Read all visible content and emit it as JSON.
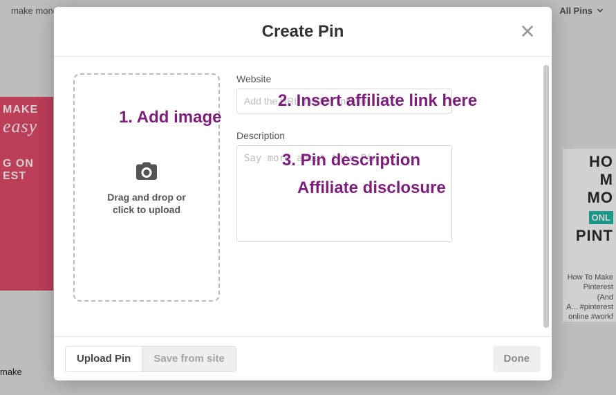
{
  "background": {
    "search_text": "make money pinning on pinterest",
    "filter_label": "All Pins",
    "left_card": {
      "l1": "MAKE",
      "l2": "easy",
      "l3": "G ON",
      "l4": "EST"
    },
    "left_caption": "make",
    "right_card": {
      "l1": "HO",
      "l2": "M",
      "l3": "MO",
      "bar": "ONL",
      "l4": "PINT",
      "caption": "How To Make\nPinterest (And\nA... #pinterest\nonline #workf"
    }
  },
  "modal": {
    "title": "Create Pin",
    "drop_line1": "Drag and drop or",
    "drop_line2": "click to upload",
    "website_label": "Website",
    "website_placeholder": "Add the URL this Pin links to",
    "description_label": "Description",
    "description_placeholder": "Say more about this Pin",
    "upload_btn": "Upload Pin",
    "save_btn": "Save from site",
    "done_btn": "Done"
  },
  "annotations": {
    "a1": "1. Add image",
    "a2": "2. Insert affiliate link here",
    "a3": "3. Pin description",
    "a4": "Affiliate disclosure"
  }
}
